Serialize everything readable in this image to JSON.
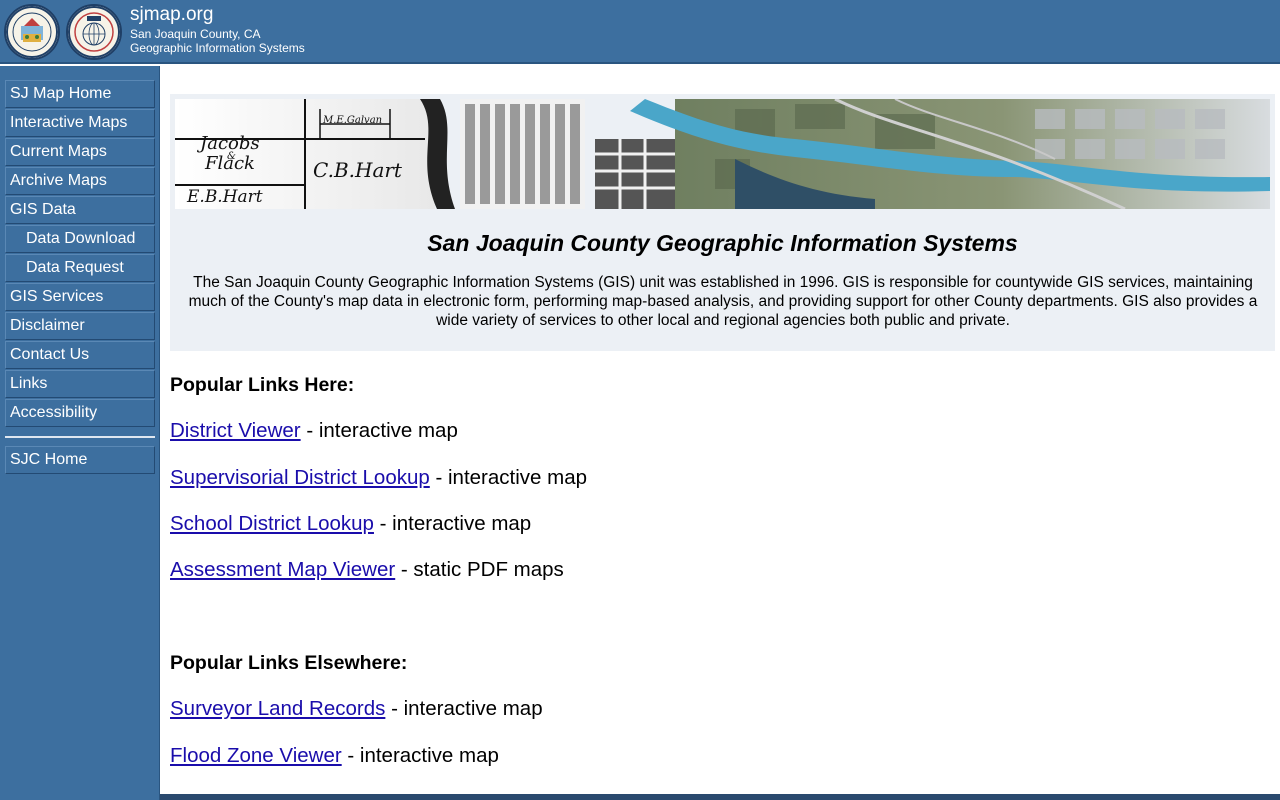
{
  "header": {
    "title": "sjmap.org",
    "subtitle1": "San Joaquin County, CA",
    "subtitle2": "Geographic Information Systems"
  },
  "sidebar": {
    "items": [
      {
        "label": "SJ Map Home"
      },
      {
        "label": "Interactive Maps"
      },
      {
        "label": "Current Maps"
      },
      {
        "label": "Archive Maps"
      },
      {
        "label": "GIS Data"
      },
      {
        "label": "Data Download"
      },
      {
        "label": "Data Request"
      },
      {
        "label": "GIS Services"
      },
      {
        "label": "Disclaimer"
      },
      {
        "label": "Contact Us"
      },
      {
        "label": "Links"
      },
      {
        "label": "Accessibility"
      }
    ],
    "home": {
      "label": "SJC Home"
    }
  },
  "banner": {
    "map_labels": [
      "M.E.Galvan",
      "Jacobs",
      "&",
      "Flack",
      "C.B.Hart",
      "E.B.Hart"
    ]
  },
  "main": {
    "title": "San Joaquin County Geographic Information Systems",
    "intro": "The San Joaquin County Geographic Information Systems (GIS) unit was established in 1996.  GIS is responsible for countywide GIS services, maintaining much of the County's map data in electronic form, performing map-based analysis, and providing support for other County departments.  GIS also provides a wide variety of services to other local and regional agencies both public and private.",
    "popular_here": {
      "heading": "Popular Links Here:",
      "links": [
        {
          "label": "District Viewer",
          "desc": " - interactive map"
        },
        {
          "label": "Supervisorial District Lookup",
          "desc": " - interactive map"
        },
        {
          "label": "School District Lookup",
          "desc": " - interactive map"
        },
        {
          "label": "Assessment Map Viewer",
          "desc": " - static PDF maps"
        }
      ]
    },
    "popular_elsewhere": {
      "heading": "Popular Links Elsewhere:",
      "links": [
        {
          "label": "Surveyor Land Records",
          "desc": " - interactive map"
        },
        {
          "label": "Flood Zone Viewer",
          "desc": " - interactive map"
        }
      ]
    }
  },
  "colors": {
    "header_bg": "#3d6f9f",
    "sidebar_bg": "#3d6f9f",
    "link": "#1a0dab",
    "banner_box_bg": "#ecf0f5"
  },
  "icons": [
    "county-seal-icon",
    "gis-seal-icon"
  ]
}
